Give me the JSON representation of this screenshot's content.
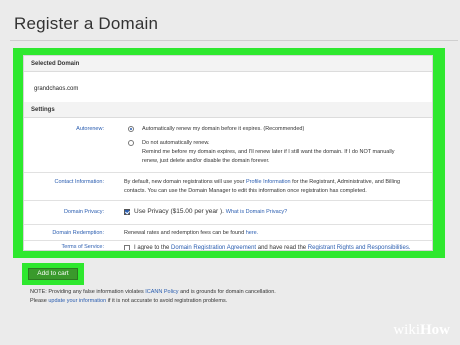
{
  "page": {
    "title": "Register a Domain"
  },
  "selected_domain": {
    "heading": "Selected Domain",
    "value": "grandchaos.com"
  },
  "settings": {
    "heading": "Settings",
    "autorenew": {
      "label": "Autorenew:",
      "option_auto": "Automatically renew my domain before it expires. (Recommended)",
      "option_manual_line1": "Do not automatically renew.",
      "option_manual_line2": "Remind me before my domain expires, and I'll renew later if I still want the domain. If I do NOT manually",
      "option_manual_line3": "renew, just delete and/or disable the domain forever.",
      "selected": "auto"
    },
    "contact": {
      "label": "Contact Information:",
      "line1_pre": "By default, new domain registrations will use your",
      "line1_link": "Profile Information",
      "line1_post": "for the Registrant, Administrative, and Billing",
      "line2": "contacts. You can use the Domain Manager to edit this information once registration has completed."
    },
    "privacy": {
      "label": "Domain Privacy:",
      "checked": true,
      "checkbox_label": "Use Privacy ($15.00 per year ).",
      "link": "What is Domain Privacy?"
    },
    "redemption": {
      "label": "Domain Redemption:",
      "text_pre": "Renewal rates and redemption fees can be found",
      "link": "here."
    },
    "terms": {
      "label": "Terms of Service:",
      "text_pre": "I agree to the",
      "link1": "Domain Registration Agreement",
      "text_mid": "and have read the",
      "link2": "Registrant Rights and Responsibilities."
    }
  },
  "actions": {
    "add_to_cart": "Add to cart"
  },
  "notes": {
    "line1_pre": "NOTE: Providing any false information violates",
    "line1_link": "ICANN Policy",
    "line1_post": "and is grounds for domain cancellation.",
    "line2_pre": "Please",
    "line2_link": "update your information",
    "line2_post": "if it is not accurate to avoid registration problems."
  },
  "watermark": {
    "prefix": "wiki",
    "suffix": "How"
  },
  "colors": {
    "highlight": "#2ee82e",
    "link": "#2a5db0",
    "button": "#3a9a2c"
  }
}
